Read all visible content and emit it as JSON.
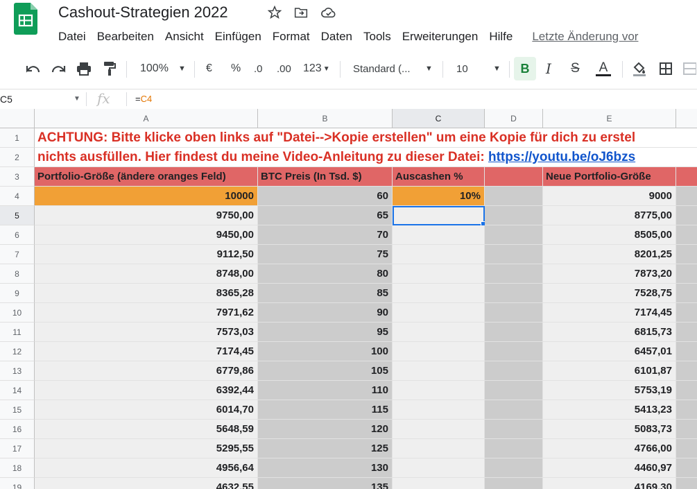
{
  "app": {
    "title": "Cashout-Strategien 2022",
    "menu": [
      "Datei",
      "Bearbeiten",
      "Ansicht",
      "Einfügen",
      "Format",
      "Daten",
      "Tools",
      "Erweiterungen",
      "Hilfe"
    ],
    "last_edit": "Letzte Änderung vor"
  },
  "toolbar": {
    "zoom": "100%",
    "currency": "€",
    "percent": "%",
    "decrease_decimals": ".0",
    "increase_decimals": ".00",
    "more_formats": "123",
    "font": "Standard (...",
    "font_size": "10",
    "bold": "B",
    "italic": "I",
    "strikethrough": "S",
    "text_color": "A"
  },
  "formula_bar": {
    "cell_ref": "C5",
    "fx": "fx",
    "formula_eq": "=",
    "formula_ref": "C4"
  },
  "columns": [
    "A",
    "B",
    "C",
    "D",
    "E"
  ],
  "selected_column": "C",
  "row_numbers": [
    "1",
    "2",
    "3",
    "4",
    "5",
    "6",
    "7",
    "8",
    "9",
    "10",
    "11",
    "12",
    "13",
    "14",
    "15",
    "16",
    "17",
    "18",
    "19"
  ],
  "selected_row": "5",
  "warning": {
    "line1": "ACHTUNG: Bitte klicke oben links auf \"Datei-->Kopie erstellen\" um eine Kopie für dich zu erstel",
    "line2": "nichts ausfüllen. Hier findest du meine Video-Anleitung zu dieser Datei: ",
    "link": "https://youtu.be/oJ6bzs"
  },
  "headers": {
    "a": "Portfolio-Größe (ändere oranges Feld)",
    "b": "BTC Preis (In Tsd. $)",
    "c": "Auscashen %",
    "e": "Neue Portfolio-Größe"
  },
  "input_row": {
    "a": "10000",
    "b": "60",
    "c": "10%",
    "e": "9000"
  },
  "data_rows": [
    {
      "a": "9750,00",
      "b": "65",
      "e": "8775,00"
    },
    {
      "a": "9450,00",
      "b": "70",
      "e": "8505,00"
    },
    {
      "a": "9112,50",
      "b": "75",
      "e": "8201,25"
    },
    {
      "a": "8748,00",
      "b": "80",
      "e": "7873,20"
    },
    {
      "a": "8365,28",
      "b": "85",
      "e": "7528,75"
    },
    {
      "a": "7971,62",
      "b": "90",
      "e": "7174,45"
    },
    {
      "a": "7573,03",
      "b": "95",
      "e": "6815,73"
    },
    {
      "a": "7174,45",
      "b": "100",
      "e": "6457,01"
    },
    {
      "a": "6779,86",
      "b": "105",
      "e": "6101,87"
    },
    {
      "a": "6392,44",
      "b": "110",
      "e": "5753,19"
    },
    {
      "a": "6014,70",
      "b": "115",
      "e": "5413,23"
    },
    {
      "a": "5648,59",
      "b": "120",
      "e": "5083,73"
    },
    {
      "a": "5295,55",
      "b": "125",
      "e": "4766,00"
    },
    {
      "a": "4956,64",
      "b": "130",
      "e": "4460,97"
    },
    {
      "a": "4632,55",
      "b": "135",
      "e": "4169,30"
    }
  ],
  "colors": {
    "orange": "#f1a036",
    "header_red": "#e06666",
    "warning_red": "#d93025",
    "link_blue": "#1155cc",
    "selection": "#1a73e8"
  },
  "icons": [
    "sheets-logo-icon",
    "star-icon",
    "move-to-folder-icon",
    "cloud-status-icon",
    "undo-icon",
    "redo-icon",
    "print-icon",
    "paint-format-icon",
    "fill-color-icon",
    "borders-icon",
    "merge-icon"
  ]
}
